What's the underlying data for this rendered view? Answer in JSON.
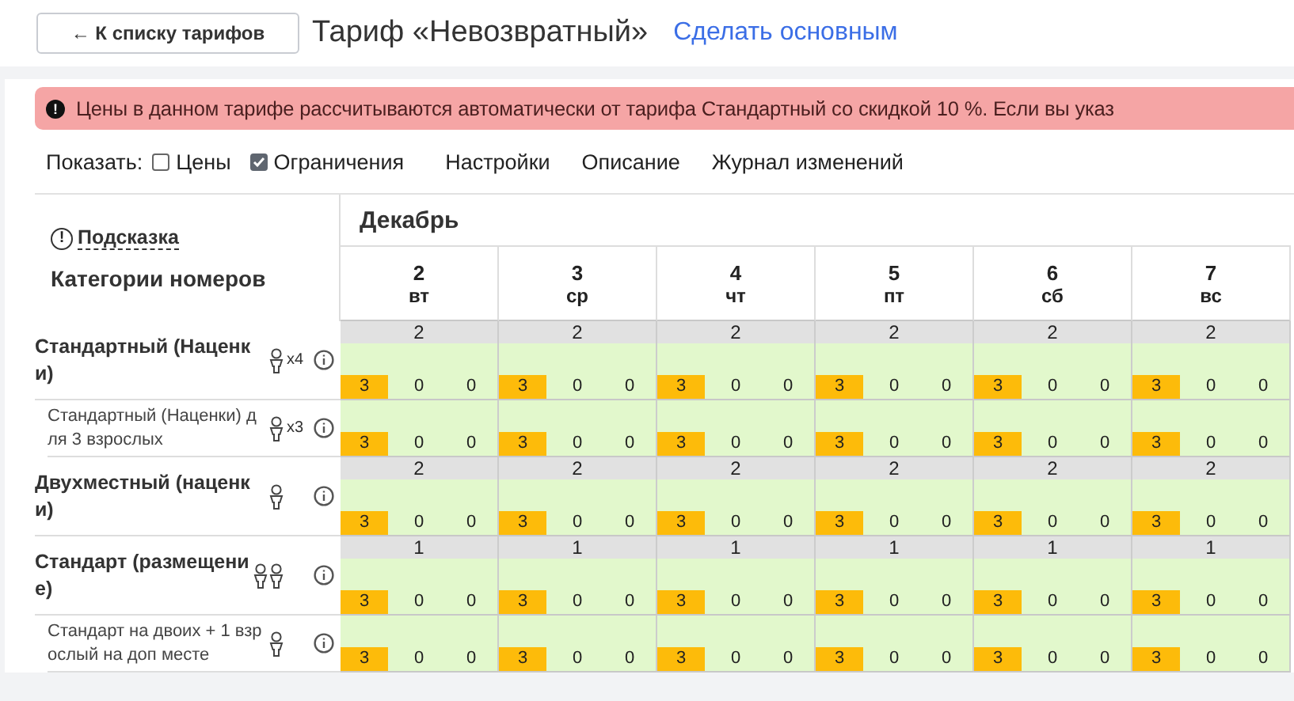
{
  "header": {
    "back_button": "← К списку тарифов",
    "title": "Тариф «Невозвратный»",
    "make_default_link": "Сделать основным"
  },
  "alert": {
    "icon": "!",
    "text": "Цены в данном тарифе рассчитываются автоматически от тарифа Стандартный со скидкой 10 %. Если вы указ"
  },
  "toolbar": {
    "show_label": "Показать:",
    "checkboxes": [
      {
        "label": "Цены",
        "checked": false
      },
      {
        "label": "Ограничения",
        "checked": true
      }
    ],
    "tabs": [
      "Настройки",
      "Описание",
      "Журнал изменений"
    ]
  },
  "grid": {
    "hint": "Подсказка",
    "categories_heading": "Категории номеров",
    "month": "Декабрь",
    "days": [
      {
        "date": "2",
        "weekday": "вт"
      },
      {
        "date": "3",
        "weekday": "ср"
      },
      {
        "date": "4",
        "weekday": "чт"
      },
      {
        "date": "5",
        "weekday": "пт"
      },
      {
        "date": "6",
        "weekday": "сб"
      },
      {
        "date": "7",
        "weekday": "вс"
      }
    ],
    "rows": [
      {
        "kind": "room",
        "name": "Стандартный (Наценки)",
        "guests": [
          {
            "kind": "person"
          }
        ],
        "multiplier": "x4",
        "cells": [
          {
            "availability": "2",
            "values": [
              {
                "value": "3",
                "highlighted": true
              },
              {
                "value": "0",
                "highlighted": false
              },
              {
                "value": "0",
                "highlighted": false
              }
            ]
          },
          {
            "availability": "2",
            "values": [
              {
                "value": "3",
                "highlighted": true
              },
              {
                "value": "0",
                "highlighted": false
              },
              {
                "value": "0",
                "highlighted": false
              }
            ]
          },
          {
            "availability": "2",
            "values": [
              {
                "value": "3",
                "highlighted": true
              },
              {
                "value": "0",
                "highlighted": false
              },
              {
                "value": "0",
                "highlighted": false
              }
            ]
          },
          {
            "availability": "2",
            "values": [
              {
                "value": "3",
                "highlighted": true
              },
              {
                "value": "0",
                "highlighted": false
              },
              {
                "value": "0",
                "highlighted": false
              }
            ]
          },
          {
            "availability": "2",
            "values": [
              {
                "value": "3",
                "highlighted": true
              },
              {
                "value": "0",
                "highlighted": false
              },
              {
                "value": "0",
                "highlighted": false
              }
            ]
          },
          {
            "availability": "2",
            "values": [
              {
                "value": "3",
                "highlighted": true
              },
              {
                "value": "0",
                "highlighted": false
              },
              {
                "value": "0",
                "highlighted": false
              }
            ]
          }
        ]
      },
      {
        "kind": "variant",
        "name": "Стандартный (Наценки) для 3 взрослых",
        "guests": [
          {
            "kind": "person"
          }
        ],
        "multiplier": "x3",
        "cells": [
          {
            "values": [
              {
                "value": "3",
                "highlighted": true
              },
              {
                "value": "0",
                "highlighted": false
              },
              {
                "value": "0",
                "highlighted": false
              }
            ]
          },
          {
            "values": [
              {
                "value": "3",
                "highlighted": true
              },
              {
                "value": "0",
                "highlighted": false
              },
              {
                "value": "0",
                "highlighted": false
              }
            ]
          },
          {
            "values": [
              {
                "value": "3",
                "highlighted": true
              },
              {
                "value": "0",
                "highlighted": false
              },
              {
                "value": "0",
                "highlighted": false
              }
            ]
          },
          {
            "values": [
              {
                "value": "3",
                "highlighted": true
              },
              {
                "value": "0",
                "highlighted": false
              },
              {
                "value": "0",
                "highlighted": false
              }
            ]
          },
          {
            "values": [
              {
                "value": "3",
                "highlighted": true
              },
              {
                "value": "0",
                "highlighted": false
              },
              {
                "value": "0",
                "highlighted": false
              }
            ]
          },
          {
            "values": [
              {
                "value": "3",
                "highlighted": true
              },
              {
                "value": "0",
                "highlighted": false
              },
              {
                "value": "0",
                "highlighted": false
              }
            ]
          }
        ]
      },
      {
        "kind": "room",
        "name": "Двухместный (наценки)",
        "guests": [
          {
            "kind": "person"
          }
        ],
        "cells": [
          {
            "availability": "2",
            "values": [
              {
                "value": "3",
                "highlighted": true
              },
              {
                "value": "0",
                "highlighted": false
              },
              {
                "value": "0",
                "highlighted": false
              }
            ]
          },
          {
            "availability": "2",
            "values": [
              {
                "value": "3",
                "highlighted": true
              },
              {
                "value": "0",
                "highlighted": false
              },
              {
                "value": "0",
                "highlighted": false
              }
            ]
          },
          {
            "availability": "2",
            "values": [
              {
                "value": "3",
                "highlighted": true
              },
              {
                "value": "0",
                "highlighted": false
              },
              {
                "value": "0",
                "highlighted": false
              }
            ]
          },
          {
            "availability": "2",
            "values": [
              {
                "value": "3",
                "highlighted": true
              },
              {
                "value": "0",
                "highlighted": false
              },
              {
                "value": "0",
                "highlighted": false
              }
            ]
          },
          {
            "availability": "2",
            "values": [
              {
                "value": "3",
                "highlighted": true
              },
              {
                "value": "0",
                "highlighted": false
              },
              {
                "value": "0",
                "highlighted": false
              }
            ]
          },
          {
            "availability": "2",
            "values": [
              {
                "value": "3",
                "highlighted": true
              },
              {
                "value": "0",
                "highlighted": false
              },
              {
                "value": "0",
                "highlighted": false
              }
            ]
          }
        ]
      },
      {
        "kind": "room",
        "name": "Стандарт (размещение)",
        "guests": [
          {
            "kind": "person"
          },
          {
            "kind": "person"
          }
        ],
        "cells": [
          {
            "availability": "1",
            "values": [
              {
                "value": "3",
                "highlighted": true
              },
              {
                "value": "0",
                "highlighted": false
              },
              {
                "value": "0",
                "highlighted": false
              }
            ]
          },
          {
            "availability": "1",
            "values": [
              {
                "value": "3",
                "highlighted": true
              },
              {
                "value": "0",
                "highlighted": false
              },
              {
                "value": "0",
                "highlighted": false
              }
            ]
          },
          {
            "availability": "1",
            "values": [
              {
                "value": "3",
                "highlighted": true
              },
              {
                "value": "0",
                "highlighted": false
              },
              {
                "value": "0",
                "highlighted": false
              }
            ]
          },
          {
            "availability": "1",
            "values": [
              {
                "value": "3",
                "highlighted": true
              },
              {
                "value": "0",
                "highlighted": false
              },
              {
                "value": "0",
                "highlighted": false
              }
            ]
          },
          {
            "availability": "1",
            "values": [
              {
                "value": "3",
                "highlighted": true
              },
              {
                "value": "0",
                "highlighted": false
              },
              {
                "value": "0",
                "highlighted": false
              }
            ]
          },
          {
            "availability": "1",
            "values": [
              {
                "value": "3",
                "highlighted": true
              },
              {
                "value": "0",
                "highlighted": false
              },
              {
                "value": "0",
                "highlighted": false
              }
            ]
          }
        ]
      },
      {
        "kind": "variant",
        "name": "Стандарт на двоих + 1 взрослый на доп месте",
        "guests": [
          {
            "kind": "person"
          }
        ],
        "cells": [
          {
            "values": [
              {
                "value": "3",
                "highlighted": true
              },
              {
                "value": "0",
                "highlighted": false
              },
              {
                "value": "0",
                "highlighted": false
              }
            ]
          },
          {
            "values": [
              {
                "value": "3",
                "highlighted": true
              },
              {
                "value": "0",
                "highlighted": false
              },
              {
                "value": "0",
                "highlighted": false
              }
            ]
          },
          {
            "values": [
              {
                "value": "3",
                "highlighted": true
              },
              {
                "value": "0",
                "highlighted": false
              },
              {
                "value": "0",
                "highlighted": false
              }
            ]
          },
          {
            "values": [
              {
                "value": "3",
                "highlighted": true
              },
              {
                "value": "0",
                "highlighted": false
              },
              {
                "value": "0",
                "highlighted": false
              }
            ]
          },
          {
            "values": [
              {
                "value": "3",
                "highlighted": true
              },
              {
                "value": "0",
                "highlighted": false
              },
              {
                "value": "0",
                "highlighted": false
              }
            ]
          },
          {
            "values": [
              {
                "value": "3",
                "highlighted": true
              },
              {
                "value": "0",
                "highlighted": false
              },
              {
                "value": "0",
                "highlighted": false
              }
            ]
          }
        ]
      }
    ]
  }
}
